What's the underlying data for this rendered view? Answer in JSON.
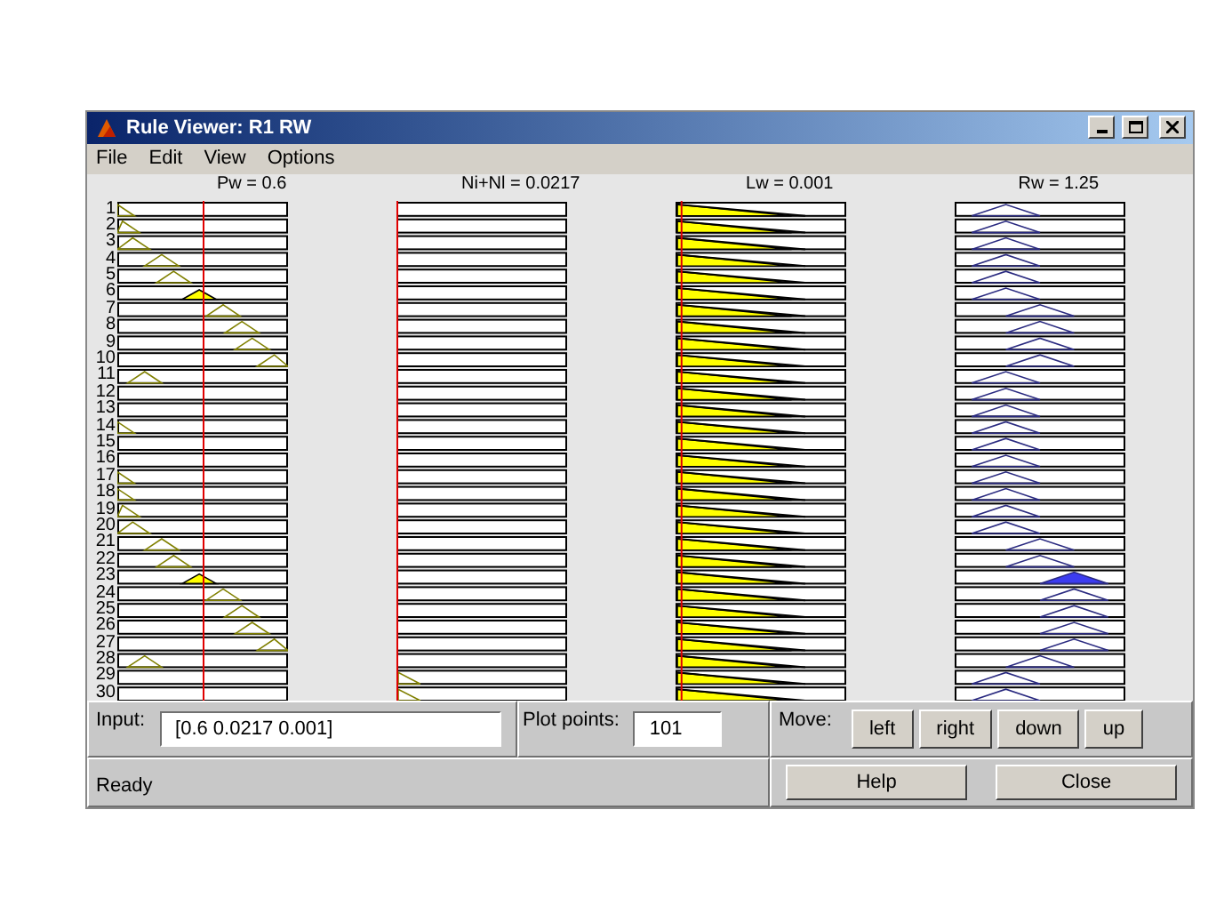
{
  "window": {
    "title": "Rule Viewer: R1 RW"
  },
  "menu": [
    "File",
    "Edit",
    "View",
    "Options"
  ],
  "variables": [
    {
      "label": "Pw = 0.6",
      "kind": "input"
    },
    {
      "label": "Ni+Nl = 0.0217",
      "kind": "input"
    },
    {
      "label": "Lw = 0.001",
      "kind": "input"
    },
    {
      "label": "Rw = 1.25",
      "kind": "output"
    }
  ],
  "rules": [
    "1",
    "2",
    "3",
    "4",
    "5",
    "6",
    "7",
    "8",
    "9",
    "10",
    "11",
    "12",
    "13",
    "14",
    "15",
    "16",
    "17",
    "18",
    "19",
    "20",
    "21",
    "22",
    "23",
    "24",
    "25",
    "26",
    "27",
    "28",
    "29",
    "30"
  ],
  "input": {
    "label": "Input:",
    "value": "[0.6 0.0217 0.001]"
  },
  "plot_points": {
    "label": "Plot points:",
    "value": "101"
  },
  "move": {
    "label": "Move:",
    "buttons": [
      "left",
      "right",
      "down",
      "up"
    ]
  },
  "status": "Ready",
  "buttons": [
    "Help",
    "Close"
  ]
}
